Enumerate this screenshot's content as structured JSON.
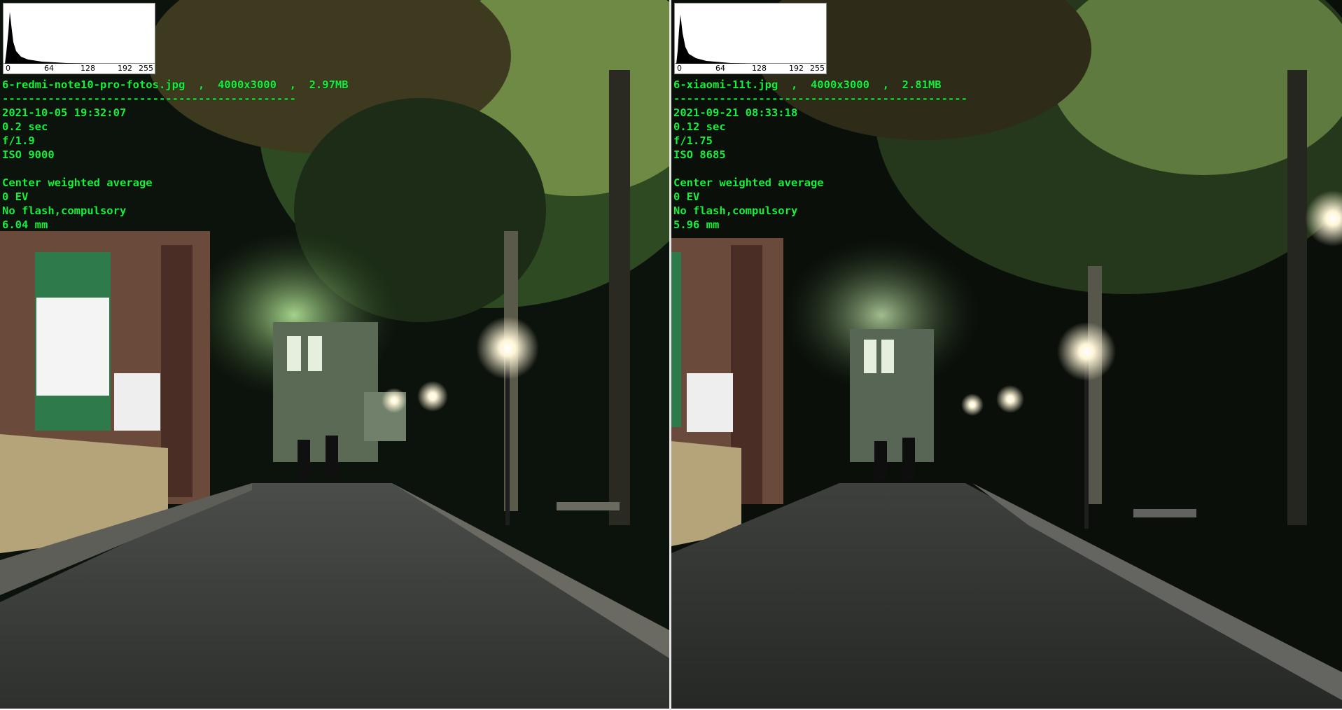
{
  "panels": [
    {
      "histogram": {
        "ticks": [
          "0",
          "64",
          "128",
          "192",
          "255"
        ]
      },
      "file_line": "6-redmi-note10-pro-fotos.jpg  ,  4000x3000  ,  2.97MB",
      "separator": "---------------------------------------------",
      "datetime": "2021-10-05 19:32:07",
      "exposure": "0.2 sec",
      "aperture": "f/1.9",
      "iso": "ISO 9000",
      "metering": "Center weighted average",
      "ev": "0 EV",
      "flash": "No flash,compulsory",
      "focal_length": "6.04 mm"
    },
    {
      "histogram": {
        "ticks": [
          "0",
          "64",
          "128",
          "192",
          "255"
        ]
      },
      "file_line": "6-xiaomi-11t.jpg  ,  4000x3000  ,  2.81MB",
      "separator": "---------------------------------------------",
      "datetime": "2021-09-21 08:33:18",
      "exposure": "0.12 sec",
      "aperture": "f/1.75",
      "iso": "ISO 8685",
      "metering": "Center weighted average",
      "ev": "0 EV",
      "flash": "No flash,compulsory",
      "focal_length": "5.96 mm"
    }
  ],
  "colors": {
    "overlay_text": "#16f03b",
    "divider": "#e6e6e6"
  }
}
